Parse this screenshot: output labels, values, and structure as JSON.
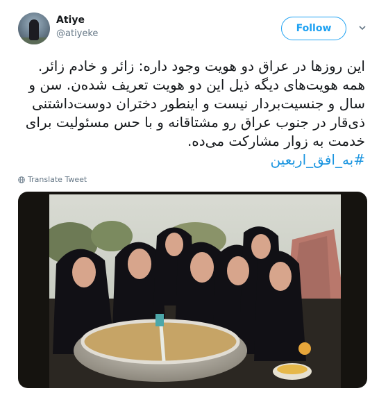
{
  "user": {
    "name": "Atiye",
    "handle": "@atiyeke",
    "follow_label": "Follow"
  },
  "tweet": {
    "lines": [
      "این روزها در عراق دو هویت وجود داره: زائر و خادم زائر.",
      "همه هویت‌های دیگه ذیل این دو هویت تعریف شده‌ن. سن و",
      "سال و جنسیت‌بردار نیست و اینطور دختران دوست‌داشتنی",
      "ذی‌قار در جنوب عراق رو مشتاقانه و با حس مسئولیت برای",
      "خدمت به زوار مشارکت می‌ده."
    ],
    "hashtag": "#به_افق_اربعین",
    "translate_label": "Translate Tweet"
  },
  "media": {
    "description_icon": "photo"
  },
  "colors": {
    "accent": "#1da1f2",
    "link": "#1b95e0",
    "muted": "#657786"
  }
}
